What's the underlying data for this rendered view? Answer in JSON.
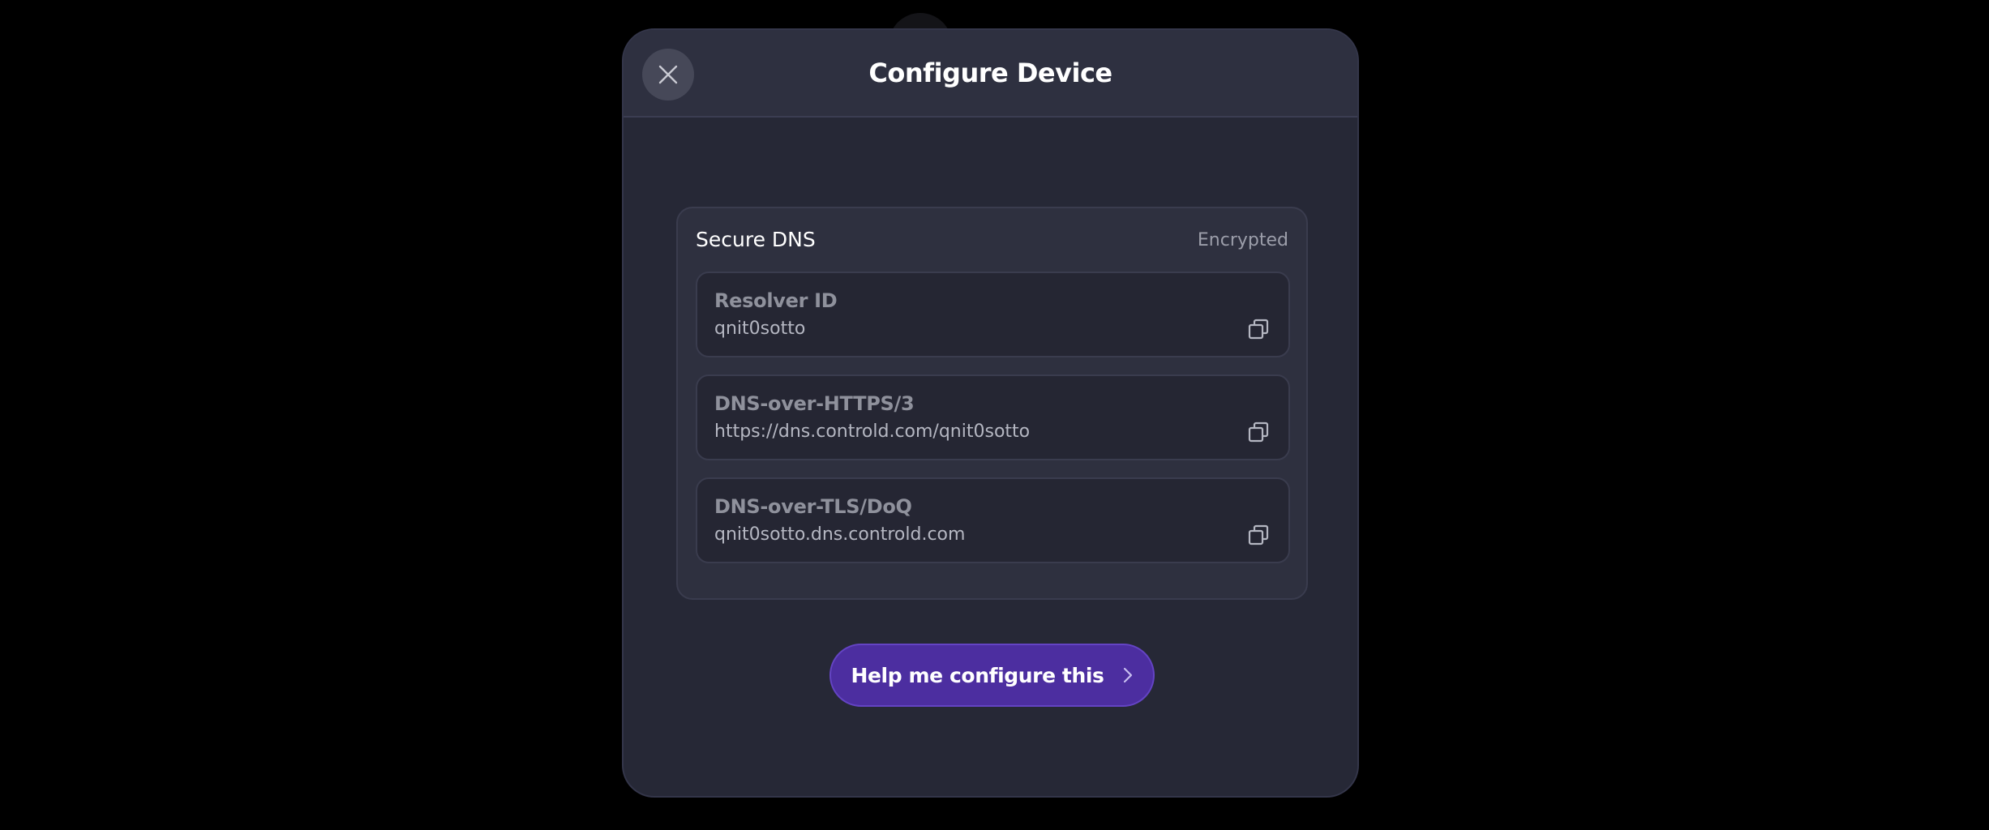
{
  "modal": {
    "title": "Configure Device"
  },
  "secure_dns": {
    "title": "Secure DNS",
    "badge": "Encrypted",
    "fields": [
      {
        "label": "Resolver ID",
        "value": "qnit0sotto",
        "icon": "copy-icon"
      },
      {
        "label": "DNS-over-HTTPS/3",
        "value": "https://dns.controld.com/qnit0sotto",
        "icon": "copy-icon"
      },
      {
        "label": "DNS-over-TLS/DoQ",
        "value": "qnit0sotto.dns.controld.com",
        "icon": "copy-icon"
      }
    ]
  },
  "help_button": {
    "label": "Help me configure this",
    "icon": "chevron-right-icon"
  },
  "colors": {
    "modal_bg": "#262836",
    "header_bg": "#2e3040",
    "accent_button": "#4c2ea0",
    "accent_border": "#6444c4"
  }
}
